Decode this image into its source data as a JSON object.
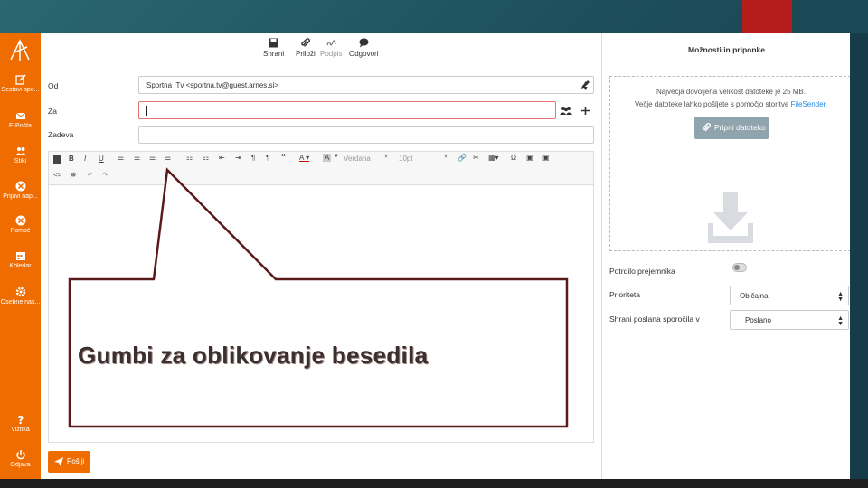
{
  "sidebar": {
    "items": [
      {
        "label": "Sestavi spo...",
        "icon": "compose-icon"
      },
      {
        "label": "E-Pošta",
        "icon": "mail-icon"
      },
      {
        "label": "Stiki",
        "icon": "contacts-icon"
      },
      {
        "label": "Prijavi nap...",
        "icon": "bug-icon"
      },
      {
        "label": "Pomoč",
        "icon": "help-circle-icon"
      },
      {
        "label": "Koledar",
        "icon": "calendar-icon"
      },
      {
        "label": "Osebne nas...",
        "icon": "gear-icon"
      },
      {
        "label": "Vizitka",
        "icon": "question-icon"
      },
      {
        "label": "Odjava",
        "icon": "power-icon"
      }
    ]
  },
  "toolbar": {
    "save": "Shrani",
    "attach": "Priloži",
    "signature": "Podpis",
    "reply": "Odgovori"
  },
  "form": {
    "from_label": "Od",
    "from_value": "Sportna_Tv <sportna.tv@guest.arnes.si>",
    "to_label": "Za",
    "subject_label": "Zadeva"
  },
  "editor": {
    "font": "Verdana",
    "size": "10pt"
  },
  "send_label": "Pošlji",
  "options": {
    "title": "Možnosti in priponke",
    "max_size_text": "Največja dovoljena velikost datoteke je 25 MB.",
    "large_files_text": "Večje datoteke lahko pošljete s pomočjo storitve",
    "link_text": "FileSender.",
    "attach_button": "Pripni datoteko",
    "read_receipt_label": "Potrdilo prejemnika",
    "priority_label": "Prioriteta",
    "priority_value": "Običajna",
    "save_sent_label": "Shrani poslana sporočila v",
    "save_sent_value": "Poslano"
  },
  "callout": {
    "text": "Gumbi za oblikovanje besedila"
  },
  "colors": {
    "accent": "#ef6c00",
    "callout_border": "#5a1a1a"
  }
}
